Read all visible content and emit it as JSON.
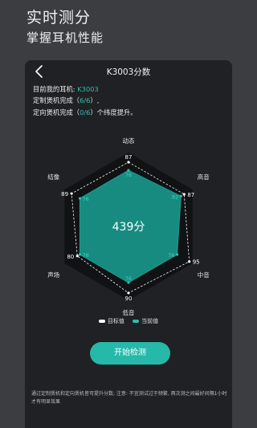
{
  "header": {
    "title": "实时测分",
    "subtitle": "掌握耳机性能"
  },
  "card": {
    "title": "K3003分数",
    "info": {
      "earphone_prefix": "目前我的耳机: ",
      "earphone_model": "K3003",
      "custom_prefix": "定制煲机完成（",
      "custom_value": "6/6",
      "custom_suffix": "）,",
      "directed_prefix": "定向煲机完成（",
      "directed_value": "0/6",
      "directed_suffix": "）个纬度提升。"
    },
    "score_text": "439分",
    "start_button": "开始检测",
    "note": "通过定制煲机和定向煲机皆可提升分数; 注意: 不宜测试过于频繁, 两次测之间最好间隔1小时才有明显效果"
  },
  "chart_data": {
    "type": "radar",
    "axes": [
      "动态",
      "高音",
      "中音",
      "低音",
      "声场",
      "结像"
    ],
    "ylim": [
      0,
      100
    ],
    "series": [
      {
        "name": "目标值",
        "values": [
          87,
          87,
          95,
          90,
          80,
          89
        ]
      },
      {
        "name": "当前值",
        "values": [
          76,
          82,
          76,
          76,
          76,
          76
        ]
      }
    ],
    "legend": "bottom",
    "colors": {
      "target": "#ffffff",
      "current": "#2ebfae"
    }
  },
  "colors": {
    "background": "#3b3d41",
    "card": "#202124",
    "accent": "#26b8a9"
  },
  "icons": {
    "back": "chevron-left-icon"
  }
}
